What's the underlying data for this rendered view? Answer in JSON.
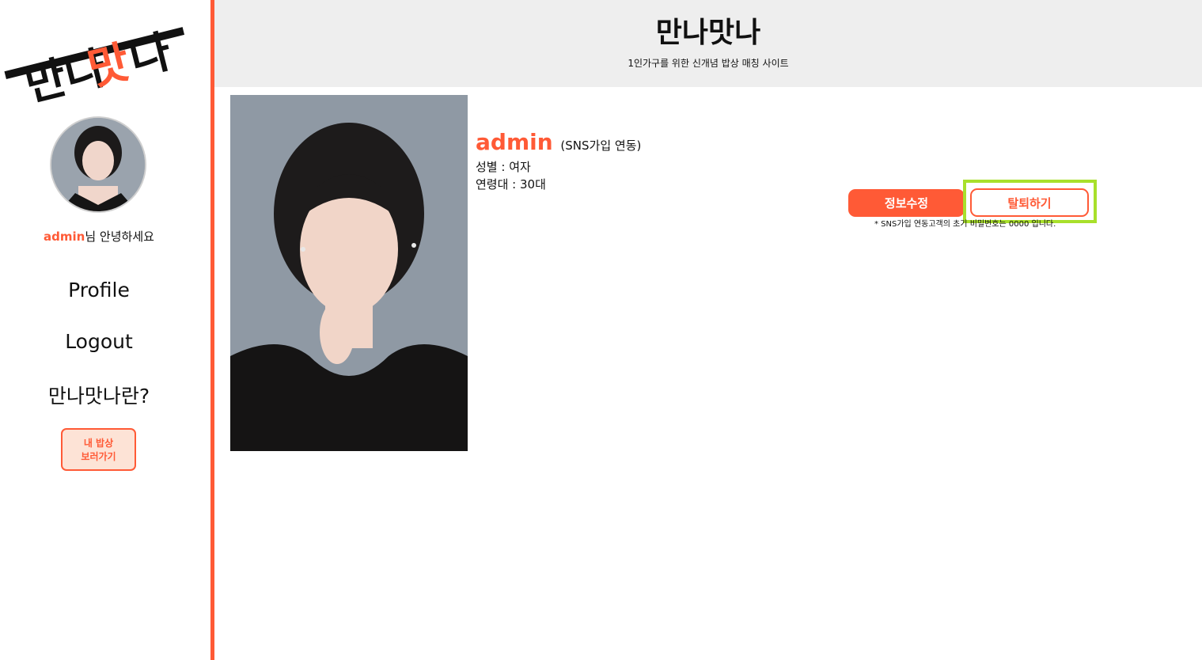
{
  "app": {
    "logo_text": "만나맛나",
    "header_title": "만나맛나",
    "header_subtitle": "1인가구를 위한 신개념 밥상 매칭 사이트"
  },
  "sidebar": {
    "greeting_user": "admin",
    "greeting_suffix": "님 안녕하세요",
    "nav": [
      "Profile",
      "Logout",
      "만나맛나란?"
    ],
    "mybab_line1": "내 밥상",
    "mybab_line2": "보러가기"
  },
  "profile": {
    "username": "admin",
    "sns_label": "(SNS가입 연동)",
    "gender": "성별 : 여자",
    "age_group": "연령대 : 30대",
    "edit_button": "정보수정",
    "withdraw_button": "탈퇴하기",
    "note": "* SNS가입 연동고객의 초기 비밀번호는 0000 입니다."
  },
  "colors": {
    "accent": "#ff5a36",
    "header_bg": "#eeeeee",
    "highlight": "#a8e02b"
  }
}
